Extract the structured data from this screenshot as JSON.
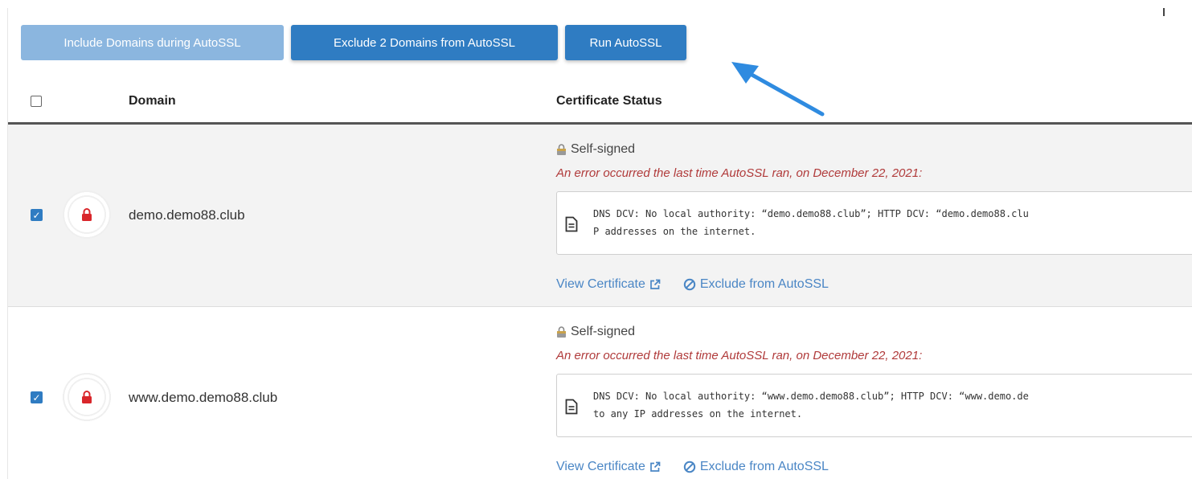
{
  "toolbar": {
    "include_label": "Include Domains during AutoSSL",
    "exclude_label": "Exclude 2 Domains from AutoSSL",
    "run_label": "Run AutoSSL"
  },
  "table": {
    "headers": {
      "domain": "Domain",
      "status": "Certificate Status"
    },
    "rows": [
      {
        "checked": true,
        "domain": "demo.demo88.club",
        "status": "Self-signed",
        "error": "An error occurred the last time AutoSSL ran, on December 22, 2021:",
        "message_line1": "DNS DCV: No local authority: “demo.demo88.club”; HTTP DCV: “demo.demo88.clu",
        "message_line2": "P addresses on the internet.",
        "view_link": "View Certificate",
        "exclude_link": "Exclude from AutoSSL"
      },
      {
        "checked": true,
        "domain": "www.demo.demo88.club",
        "status": "Self-signed",
        "error": "An error occurred the last time AutoSSL ran, on December 22, 2021:",
        "message_line1": "DNS DCV: No local authority: “www.demo.demo88.club”; HTTP DCV: “www.demo.de",
        "message_line2": "to any IP addresses on the internet.",
        "view_link": "View Certificate",
        "exclude_link": "Exclude from AutoSSL"
      }
    ]
  },
  "colors": {
    "primary": "#2f7cc2",
    "primary_light": "#8bb6df",
    "error": "#b03a3a",
    "link": "#4a86c5",
    "lock": "#d9262b",
    "arrow": "#2f8be0"
  }
}
